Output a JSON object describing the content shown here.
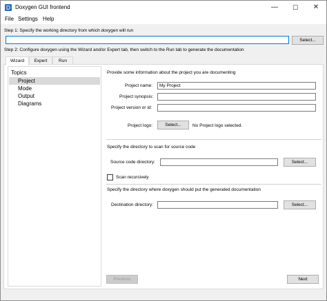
{
  "window": {
    "title": "Doxygen GUI frontend",
    "minimize": "—",
    "maximize": "☐",
    "close": "✕"
  },
  "menu": {
    "items": [
      "File",
      "Settings",
      "Help"
    ]
  },
  "step1": {
    "label": "Step 1: Specify the working directory from which doxygen will run",
    "value": "",
    "select_label": "Select..."
  },
  "step2": {
    "label": "Step 2: Configure doxygen using the Wizard and/or Expert tab, then switch to the Run tab to generate the documentation"
  },
  "tabs": [
    {
      "label": "Wizard"
    },
    {
      "label": "Expert"
    },
    {
      "label": "Run"
    }
  ],
  "topics": {
    "header": "Topics",
    "items": [
      "Project",
      "Mode",
      "Output",
      "Diagrams"
    ],
    "selected": "Project"
  },
  "project": {
    "intro": "Provide some information about the project you are documenting",
    "name_label": "Project name:",
    "name_value": "My Project",
    "synopsis_label": "Project synopsis:",
    "synopsis_value": "",
    "version_label": "Project version or id:",
    "version_value": "",
    "logo_label": "Project logo:",
    "logo_button": "Select...",
    "logo_status": "No Project logo selected."
  },
  "source": {
    "intro": "Specify the directory to scan for source code",
    "dir_label": "Source code directory:",
    "dir_value": "",
    "select_label": "Select...",
    "recursive_label": "Scan recursively",
    "recursive_checked": false
  },
  "destination": {
    "intro": "Specify the directory where doxygen should put the generated documentation",
    "dir_label": "Destination directory:",
    "dir_value": "",
    "select_label": "Select..."
  },
  "nav": {
    "previous": "Previous",
    "next": "Next"
  },
  "colors": {
    "focus_border": "#0078d7",
    "selected_topic": "#d9d9d9"
  }
}
